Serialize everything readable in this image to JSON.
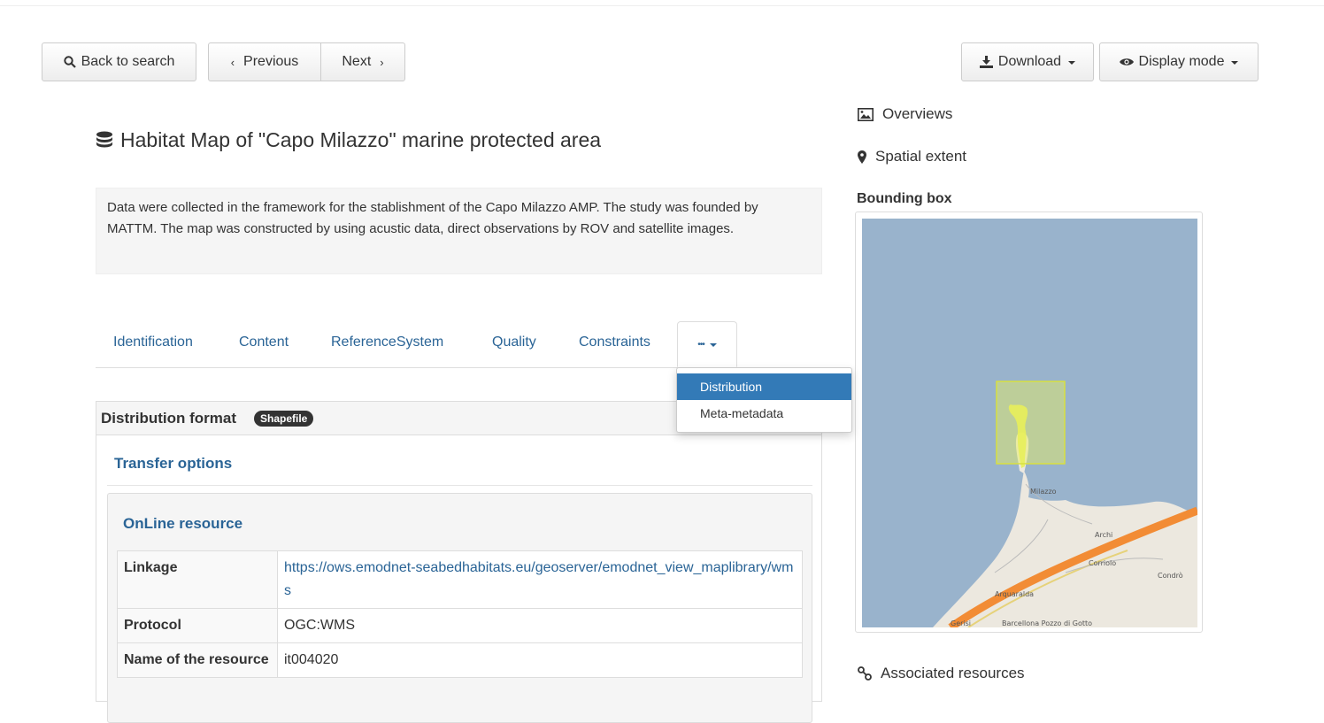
{
  "toolbar": {
    "back_label": "Back to search",
    "previous_label": "Previous",
    "next_label": "Next",
    "download_label": "Download",
    "display_mode_label": "Display mode"
  },
  "record": {
    "title": "Habitat Map of \"Capo Milazzo\" marine protected area",
    "abstract": "Data were collected in the framework for the stablishment of the Capo Milazzo AMP. The study was founded by MATTM. The map was constructed by using acustic data, direct observations by ROV and satellite images."
  },
  "tabs": [
    {
      "label": "Identification"
    },
    {
      "label": "Content"
    },
    {
      "label": "ReferenceSystem"
    },
    {
      "label": "Quality"
    },
    {
      "label": "Constraints"
    }
  ],
  "more_tab": {
    "label": "•••",
    "menu": [
      {
        "label": "Distribution",
        "active": true
      },
      {
        "label": "Meta-metadata",
        "active": false
      }
    ]
  },
  "distribution": {
    "format_label": "Distribution format",
    "format_badge": "Shapefile",
    "transfer_title": "Transfer options",
    "online_title": "OnLine resource",
    "rows": [
      {
        "key": "Linkage",
        "value": "https://ows.emodnet-seabedhabitats.eu/geoserver/emodnet_view_maplibrary/wms"
      },
      {
        "key": "Protocol",
        "value": "OGC:WMS"
      },
      {
        "key": "Name of the resource",
        "value": "it004020"
      }
    ]
  },
  "sidebar": {
    "overviews_label": "Overviews",
    "spatial_label": "Spatial extent",
    "bbox_label": "Bounding box",
    "associated_label": "Associated resources"
  },
  "map": {
    "places": [
      "Milazzo",
      "Archi",
      "Corriolo",
      "Condrò",
      "Arquaralda",
      "Barcellona Pozzo di Gotto",
      "Gerisi"
    ],
    "colors": {
      "sea": "#99b3cc",
      "land": "#ece8df",
      "highway": "#f28c35",
      "bbox": "#e8f05a"
    }
  },
  "colors": {
    "link": "#2a6496",
    "active": "#337ab7"
  }
}
